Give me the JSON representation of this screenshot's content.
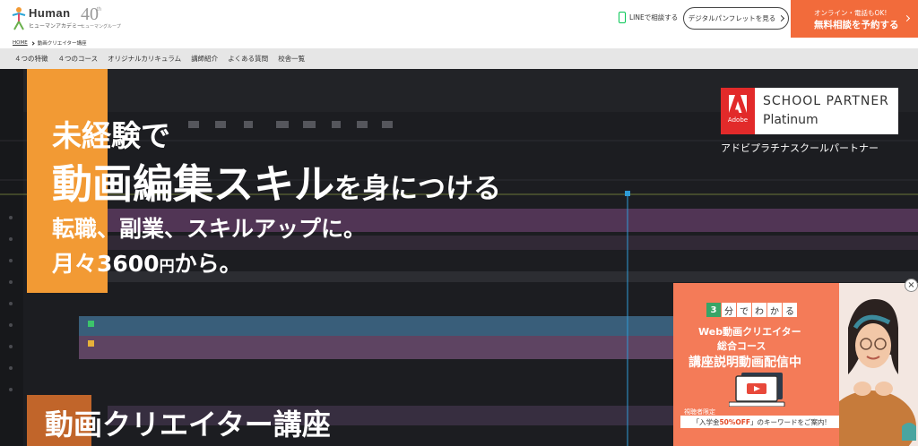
{
  "header": {
    "logo_human": "Human",
    "logo_sub": "ヒューマンアカデミー",
    "logo_40": "40",
    "logo_40th_sup": "th",
    "logo_group": "ヒューマングループ",
    "line_link": "LINEで相談する",
    "pamphlet_btn": "デジタルパンフレットを見る",
    "consult_top": "オンライン・電話もOK!",
    "consult_main": "無料相談を予約する"
  },
  "breadcrumb": {
    "home": "HOME",
    "current": "動画クリエイター講座"
  },
  "nav": {
    "items": [
      "４つの特徴",
      "４つのコース",
      "オリジナルカリキュラム",
      "講師紹介",
      "よくある質問",
      "校舎一覧"
    ]
  },
  "hero": {
    "line1": "未経験で",
    "line2_main": "動画編集スキル",
    "line2_tail": "を身につける",
    "sub1": "転職、副業、スキルアップに。",
    "sub2_a": "月々3600",
    "sub2_yen": "円",
    "sub2_b": "から。",
    "course_title": "動画クリエイター講座"
  },
  "adobe": {
    "word": "Adobe",
    "title": "SCHOOL PARTNER",
    "sub": "Platinum",
    "caption": "アドビプラチナスクールパートナー"
  },
  "popup": {
    "badge_num": "3",
    "badge_chars": [
      "分",
      "で",
      "わ",
      "か",
      "る"
    ],
    "line1": "Web動画クリエイター",
    "line2": "総合コース",
    "line3": "講座説明動画配信中",
    "viewer_tag": "視聴者限定",
    "offer_a": "「入学金",
    "offer_hl": "50%OFF",
    "offer_b": "」のキーワードをご案内!",
    "close": "×"
  },
  "colors": {
    "accent_orange": "#f26b3b",
    "hero_bar": "#f29a34",
    "popup_bg": "#f47b58",
    "adobe_red": "#e22a2a",
    "line_green": "#06c755"
  }
}
